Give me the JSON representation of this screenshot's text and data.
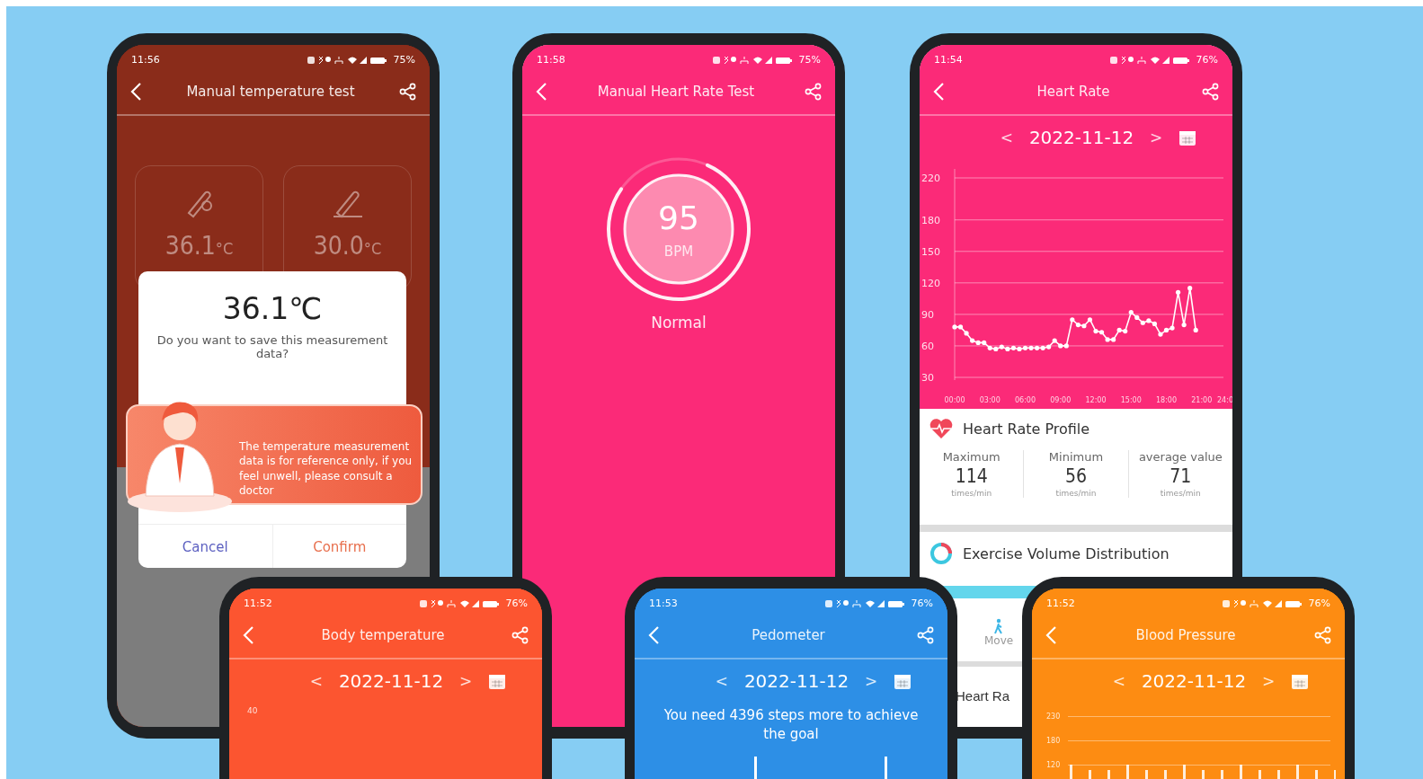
{
  "phones": [
    {
      "kind": "temperature_test",
      "color": "#8a2c1a",
      "status_bar": {
        "time": "11:56",
        "battery": "75%"
      },
      "title": "Manual temperature test",
      "readings": [
        {
          "value": "36.1",
          "unit": "°C"
        },
        {
          "value": "30.0",
          "unit": "°C"
        }
      ],
      "dialog": {
        "value": "36.1℃",
        "question": "Do you want to save this measurement data?",
        "notice": "The temperature measurement data is for reference only, if you feel unwell, please consult a doctor",
        "buttons": [
          "Cancel",
          "Confirm"
        ]
      }
    },
    {
      "kind": "heart_test",
      "color": "#fb2a78",
      "status_bar": {
        "time": "11:58",
        "battery": "75%"
      },
      "title": "Manual Heart Rate Test",
      "reading": "95",
      "unit": "BPM",
      "status": "Normal"
    },
    {
      "kind": "heart_rate",
      "color": "#fb2a78",
      "status_bar": {
        "time": "11:54",
        "battery": "76%"
      },
      "title": "Heart Rate",
      "prev": "<",
      "date": "2022-11-12",
      "next": ">",
      "chart_data": {
        "type": "line",
        "grid": true,
        "x": [
          0,
          0.5,
          1,
          1.5,
          2,
          2.5,
          3,
          3.5,
          4,
          4.5,
          5,
          5.5,
          6,
          6.5,
          7,
          7.5,
          8,
          8.5,
          9,
          9.5,
          10,
          10.5,
          11,
          11.5,
          12,
          12.5,
          13,
          13.5,
          14,
          14.5,
          15,
          15.5,
          16,
          16.5,
          17,
          17.5,
          18,
          18.5,
          19,
          19.5,
          20,
          20.5
        ],
        "series": [
          {
            "color": "#ffffff",
            "values": [
              78,
              78,
              72,
              65,
              63,
              63,
              58,
              57,
              59,
              57,
              58,
              57,
              58,
              58,
              58,
              58,
              59,
              65,
              60,
              60,
              85,
              80,
              79,
              85,
              74,
              73,
              66,
              66,
              75,
              74,
              92,
              87,
              82,
              84,
              81,
              71,
              75,
              77,
              111,
              80,
              115,
              75
            ]
          }
        ],
        "ylim": [
          30,
          220
        ],
        "yticks": [
          30,
          60,
          90,
          120,
          150,
          180,
          220
        ],
        "xlim": [
          0,
          24
        ],
        "xticks": [
          {
            "value": 0,
            "label": "00:00"
          },
          {
            "value": 3,
            "label": "03:00"
          },
          {
            "value": 6,
            "label": "06:00"
          },
          {
            "value": 9,
            "label": "09:00"
          },
          {
            "value": 12,
            "label": "12:00"
          },
          {
            "value": 15,
            "label": "15:00"
          },
          {
            "value": 18,
            "label": "18:00"
          },
          {
            "value": 21,
            "label": "21:00"
          },
          {
            "value": 24,
            "label": "24:0"
          }
        ]
      },
      "profile_title": "Heart Rate Profile",
      "stats": [
        {
          "label": "Maximum",
          "value": "114",
          "unit": "times/min"
        },
        {
          "label": "Minimum",
          "value": "56",
          "unit": "times/min"
        },
        {
          "label": "average value",
          "value": "71",
          "unit": "times/min"
        }
      ],
      "section_title": "Exercise Volume Distribution",
      "tab": "Move",
      "cut_title": "Heart Ra"
    },
    {
      "kind": "body_temperature",
      "color": "#fc5530",
      "status_bar": {
        "time": "11:52",
        "battery": "76%"
      },
      "title": "Body temperature",
      "prev": "<",
      "date": "2022-11-12",
      "next": ">",
      "axis_labels": [
        "40"
      ]
    },
    {
      "kind": "pedometer",
      "color": "#2d8fe6",
      "status_bar": {
        "time": "11:53",
        "battery": "76%"
      },
      "title": "Pedometer",
      "prev": "<",
      "date": "2022-11-12",
      "next": ">",
      "message": "You need 4396 steps more to achieve the goal"
    },
    {
      "kind": "blood_pressure",
      "color": "#fd8c12",
      "status_bar": {
        "time": "11:52",
        "battery": "76%"
      },
      "title": "Blood Pressure",
      "prev": "<",
      "date": "2022-11-12",
      "next": ">",
      "axis_labels": [
        "230",
        "180",
        "120"
      ]
    }
  ]
}
